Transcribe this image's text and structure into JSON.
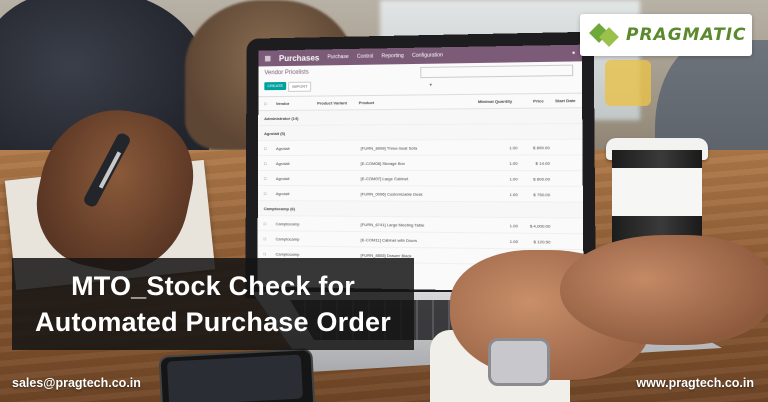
{
  "brand": {
    "logo_text": "PRAGMATIC",
    "logo_color": "#5a8a2c"
  },
  "banner": {
    "title_line1": "MTO_Stock Check for",
    "title_line2": "Automated Purchase Order"
  },
  "footer": {
    "email": "sales@pragtech.co.in",
    "website": "www.pragtech.co.in"
  },
  "screen": {
    "app_name": "Purchases",
    "menu": [
      "Purchase",
      "Control",
      "Reporting",
      "Configuration"
    ],
    "breadcrumb": "Vendor Pricelists",
    "primary_button": "CREATE",
    "secondary_button": "IMPORT",
    "columns": [
      "Vendor",
      "Product Variant",
      "Product",
      "Minimal Quantity",
      "Price",
      "Start Date",
      "End Date"
    ],
    "rows": [
      {
        "group": true,
        "label": "Administrator (14)"
      },
      {
        "group": true,
        "label": "Agrolait (5)"
      },
      {
        "vendor": "Agrolait",
        "product": "[FURN_8999] Three-Seat Sofa",
        "qty": "1.00",
        "price": "$ 890.00"
      },
      {
        "vendor": "Agrolait",
        "product": "[E-COM08] Storage Box",
        "qty": "1.00",
        "price": "$ 14.00"
      },
      {
        "vendor": "Agrolait",
        "product": "[E-COM07] Large Cabinet",
        "qty": "1.00",
        "price": "$ 800.00"
      },
      {
        "vendor": "Agrolait",
        "product": "[FURN_0096] Customizable Desk",
        "qty": "1.00",
        "price": "$ 750.00"
      },
      {
        "group": true,
        "label": "Camptocamp (6)"
      },
      {
        "vendor": "Camptocamp",
        "product": "[FURN_6741] Large Meeting Table",
        "qty": "1.00",
        "price": "$ 4,000.00"
      },
      {
        "vendor": "Camptocamp",
        "product": "[E-COM11] Cabinet with Doors",
        "qty": "1.00",
        "price": "$ 120.50"
      },
      {
        "vendor": "Camptocamp",
        "product": "[FURN_8855] Drawer Black",
        "qty": "1.00",
        "price": "$ 20.00"
      }
    ]
  }
}
